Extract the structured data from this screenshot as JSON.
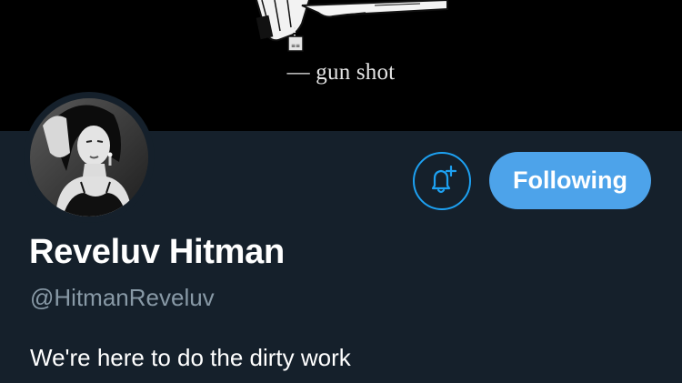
{
  "banner": {
    "caption": "— gun shot"
  },
  "profile": {
    "display_name": "Reveluv Hitman",
    "handle": "@HitmanReveluv",
    "bio": "We're here to do the dirty work"
  },
  "actions": {
    "notify_icon": "bell-plus-icon",
    "following_label": "Following"
  },
  "colors": {
    "background": "#15202b",
    "banner": "#000000",
    "accent": "#1da1f2",
    "following_button": "#4da3ea",
    "secondary_text": "#8899a6"
  }
}
